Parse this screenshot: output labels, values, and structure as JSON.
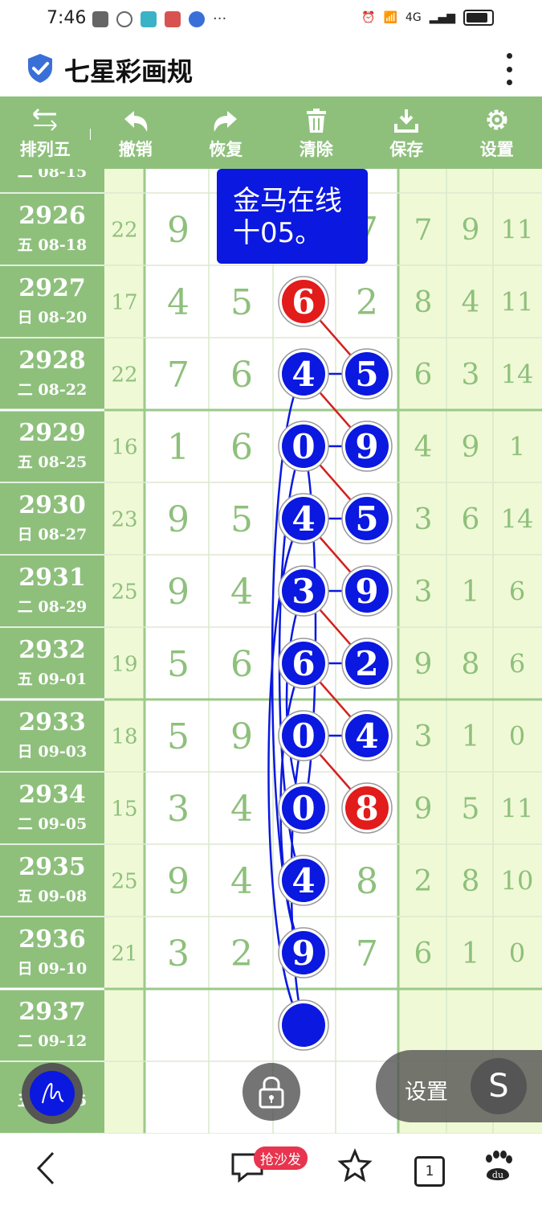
{
  "status_bar": {
    "time": "7:46",
    "network": "4G"
  },
  "app": {
    "title": "七星彩画规"
  },
  "toolbar": [
    {
      "label": "排列五",
      "icon": "swap-arrows-icon"
    },
    {
      "label": "撤销",
      "icon": "undo-icon"
    },
    {
      "label": "恢复",
      "icon": "redo-icon"
    },
    {
      "label": "清除",
      "icon": "trash-icon"
    },
    {
      "label": "保存",
      "icon": "download-icon"
    },
    {
      "label": "设置",
      "icon": "gear-icon"
    }
  ],
  "banner": {
    "line1": "金马在线",
    "line2": "十05。"
  },
  "partial_top_row": {
    "date": "二 08-15"
  },
  "rows": [
    {
      "issue": "2926",
      "date": "五 08-18",
      "sum": "22",
      "d1": "9",
      "d2": "",
      "d3": "",
      "d4": "7",
      "x1": "7",
      "x2": "9",
      "x3": "11"
    },
    {
      "issue": "2927",
      "date": "日 08-20",
      "sum": "17",
      "d1": "4",
      "d2": "5",
      "d3": "6",
      "d4": "2",
      "x1": "8",
      "x2": "4",
      "x3": "11"
    },
    {
      "issue": "2928",
      "date": "二 08-22",
      "sum": "22",
      "d1": "7",
      "d2": "6",
      "d3": "4",
      "d4": "5",
      "x1": "6",
      "x2": "3",
      "x3": "14"
    },
    {
      "issue": "2929",
      "date": "五 08-25",
      "sum": "16",
      "d1": "1",
      "d2": "6",
      "d3": "0",
      "d4": "9",
      "x1": "4",
      "x2": "9",
      "x3": "1"
    },
    {
      "issue": "2930",
      "date": "日 08-27",
      "sum": "23",
      "d1": "9",
      "d2": "5",
      "d3": "4",
      "d4": "5",
      "x1": "3",
      "x2": "6",
      "x3": "14"
    },
    {
      "issue": "2931",
      "date": "二 08-29",
      "sum": "25",
      "d1": "9",
      "d2": "4",
      "d3": "3",
      "d4": "9",
      "x1": "3",
      "x2": "1",
      "x3": "6"
    },
    {
      "issue": "2932",
      "date": "五 09-01",
      "sum": "19",
      "d1": "5",
      "d2": "6",
      "d3": "6",
      "d4": "2",
      "x1": "9",
      "x2": "8",
      "x3": "6"
    },
    {
      "issue": "2933",
      "date": "日 09-03",
      "sum": "18",
      "d1": "5",
      "d2": "9",
      "d3": "0",
      "d4": "4",
      "x1": "3",
      "x2": "1",
      "x3": "0"
    },
    {
      "issue": "2934",
      "date": "二 09-05",
      "sum": "15",
      "d1": "3",
      "d2": "4",
      "d3": "0",
      "d4": "8",
      "x1": "9",
      "x2": "5",
      "x3": "11"
    },
    {
      "issue": "2935",
      "date": "五 09-08",
      "sum": "25",
      "d1": "9",
      "d2": "4",
      "d3": "4",
      "d4": "8",
      "x1": "2",
      "x2": "8",
      "x3": "10"
    },
    {
      "issue": "2936",
      "date": "日 09-10",
      "sum": "21",
      "d1": "3",
      "d2": "2",
      "d3": "9",
      "d4": "7",
      "x1": "6",
      "x2": "1",
      "x3": "0"
    },
    {
      "issue": "2937",
      "date": "二 09-12",
      "sum": "",
      "d1": "",
      "d2": "",
      "d3": "",
      "d4": "",
      "x1": "",
      "x2": "",
      "x3": ""
    }
  ],
  "partial_bottom_row": {
    "date": "五 09-15"
  },
  "balls_col3": [
    {
      "row": 1,
      "digit": "6",
      "color": "red"
    },
    {
      "row": 2,
      "digit": "4",
      "color": "blue"
    },
    {
      "row": 3,
      "digit": "0",
      "color": "blue"
    },
    {
      "row": 4,
      "digit": "4",
      "color": "blue"
    },
    {
      "row": 5,
      "digit": "3",
      "color": "blue"
    },
    {
      "row": 6,
      "digit": "6",
      "color": "blue"
    },
    {
      "row": 7,
      "digit": "0",
      "color": "blue"
    },
    {
      "row": 8,
      "digit": "0",
      "color": "blue"
    },
    {
      "row": 9,
      "digit": "4",
      "color": "blue"
    },
    {
      "row": 10,
      "digit": "9",
      "color": "blue"
    },
    {
      "row": 11,
      "digit": "",
      "color": "blue"
    }
  ],
  "balls_col4": [
    {
      "row": 2,
      "digit": "5",
      "color": "blue"
    },
    {
      "row": 3,
      "digit": "9",
      "color": "blue"
    },
    {
      "row": 4,
      "digit": "5",
      "color": "blue"
    },
    {
      "row": 5,
      "digit": "9",
      "color": "blue"
    },
    {
      "row": 6,
      "digit": "2",
      "color": "blue"
    },
    {
      "row": 7,
      "digit": "4",
      "color": "blue"
    },
    {
      "row": 8,
      "digit": "8",
      "color": "red"
    }
  ],
  "colors": {
    "green_dark": "#8ec07c",
    "green_light": "#f0f9d6",
    "digit_green": "#8ec07c",
    "ball_blue": "#0a18e0",
    "ball_red": "#e21b1b",
    "line_red": "#d42020"
  },
  "floating": {
    "settings_label": "设置",
    "s_button": "S",
    "sofa_badge": "抢沙发",
    "tab_count": "1"
  }
}
